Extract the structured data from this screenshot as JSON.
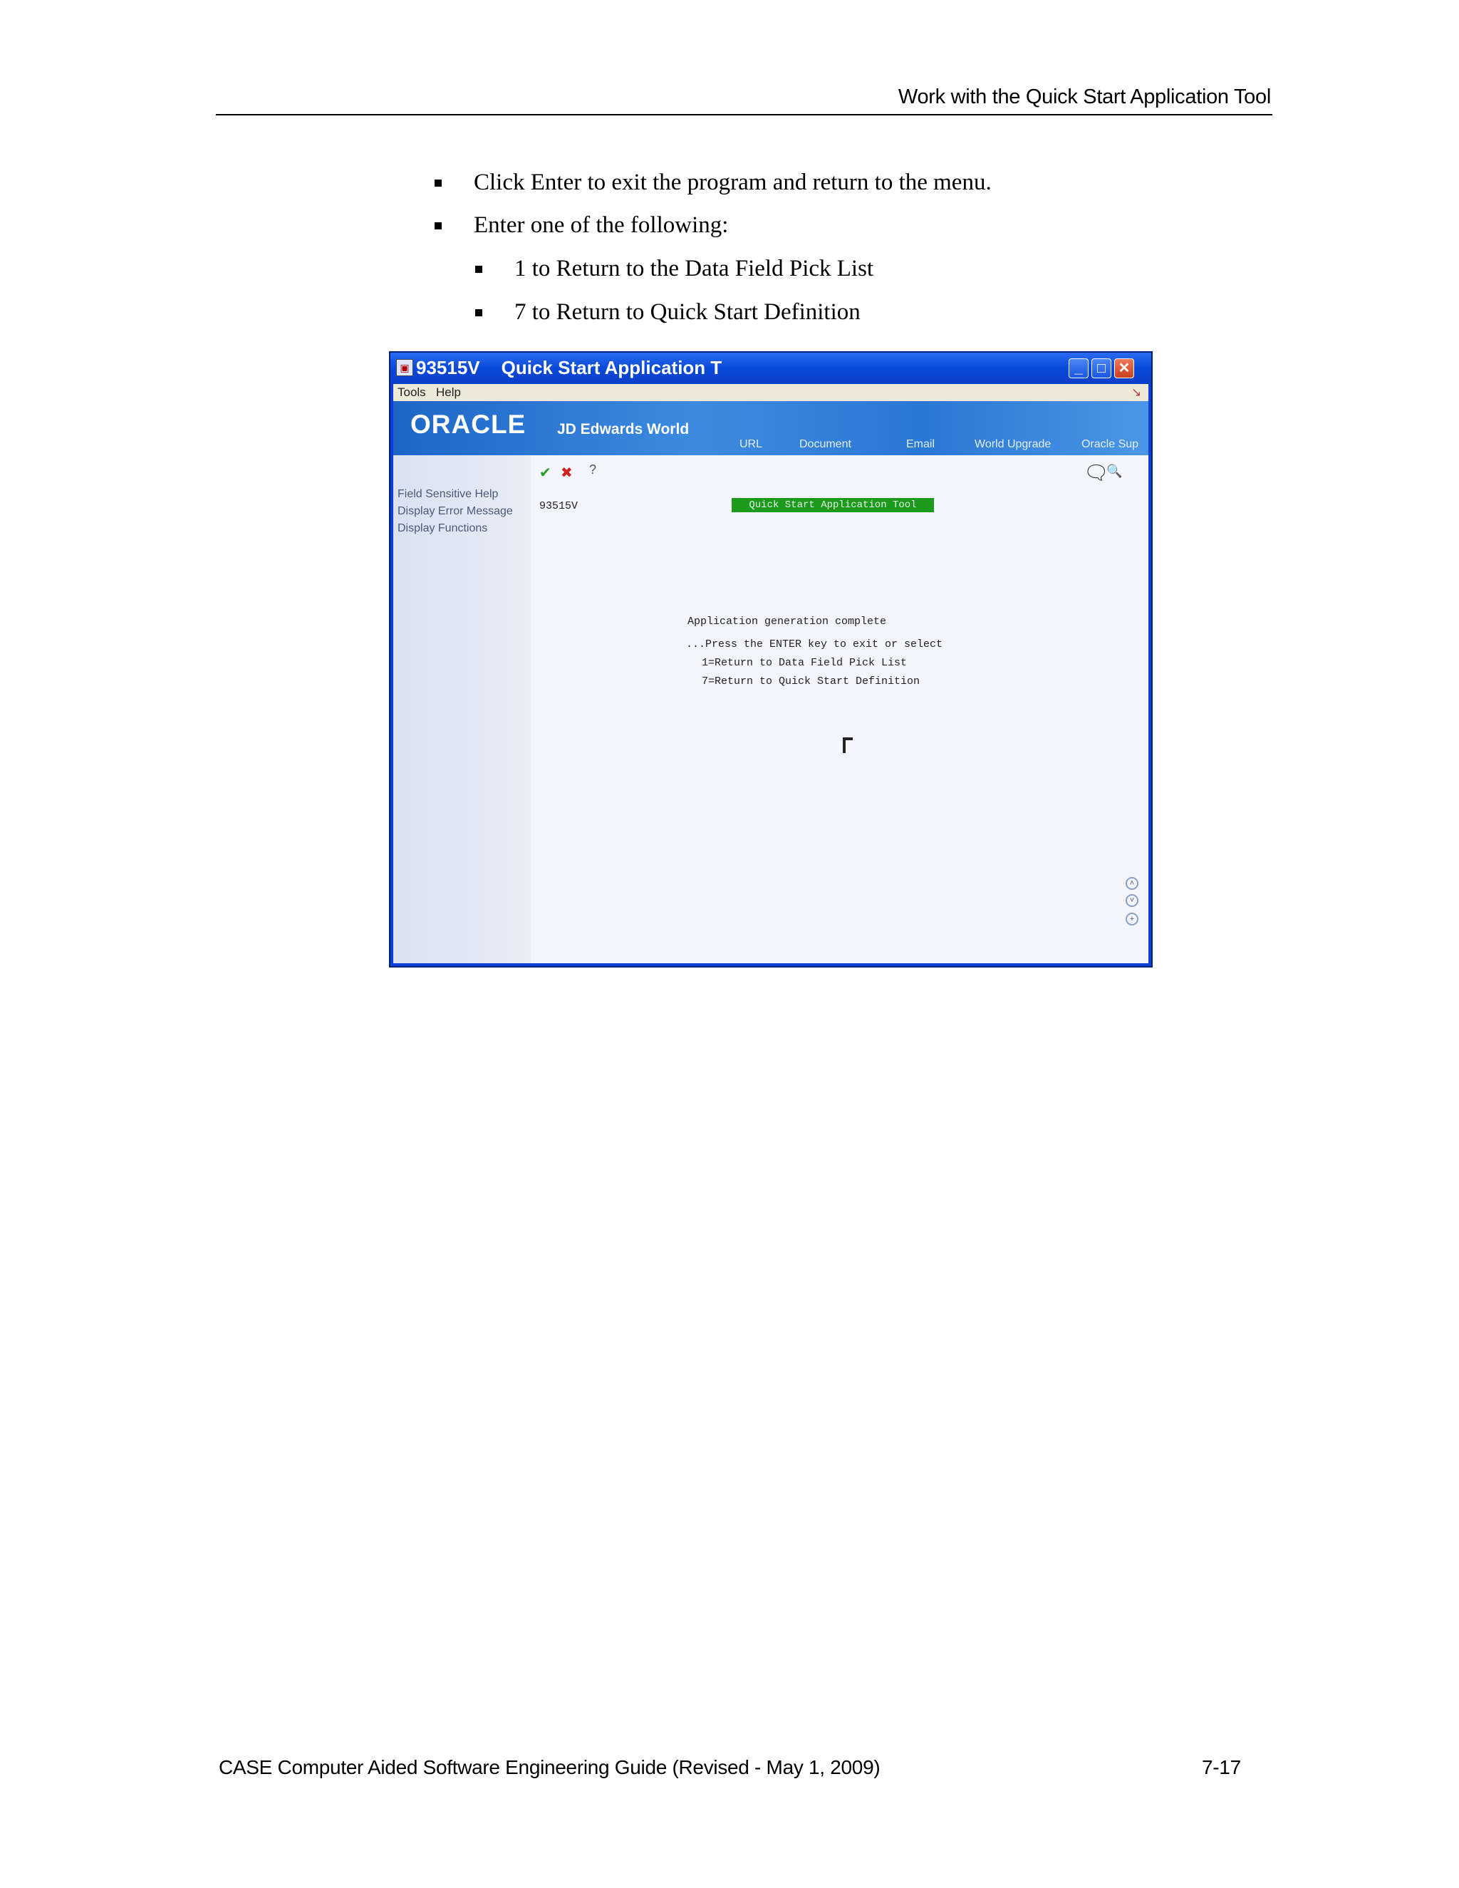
{
  "header": {
    "running_title": "Work with the Quick Start Application Tool"
  },
  "bullets": [
    {
      "text": "Click Enter to exit the program and return to the menu."
    },
    {
      "text": "Enter one of the following:"
    },
    {
      "text": "1 to Return to the Data Field Pick List"
    },
    {
      "text": "7 to Return to Quick Start Definition"
    }
  ],
  "screenshot": {
    "window_title_id": "93515V",
    "window_title": "Quick Start Application T",
    "menu": [
      "Tools",
      "Help"
    ],
    "logo": "ORACLE",
    "logo_sub": "JD Edwards World",
    "banner_links": [
      "URL",
      "Document",
      "Email",
      "World Upgrade",
      "Oracle Sup"
    ],
    "left_links": [
      "Field Sensitive Help",
      "Display Error Message",
      "Display Functions"
    ],
    "program_id": "93515V",
    "screen_title": "Quick Start Application Tool",
    "message": "Application generation complete",
    "prompt": "...Press the ENTER key to exit or select",
    "option1": "1=Return to Data Field Pick List",
    "option7": "7=Return to Quick Start Definition",
    "help_glyph": "?"
  },
  "footer": {
    "guide_title": "CASE Computer Aided Software Engineering Guide (Revised - May 1, 2009)",
    "page_number": "7-17"
  }
}
